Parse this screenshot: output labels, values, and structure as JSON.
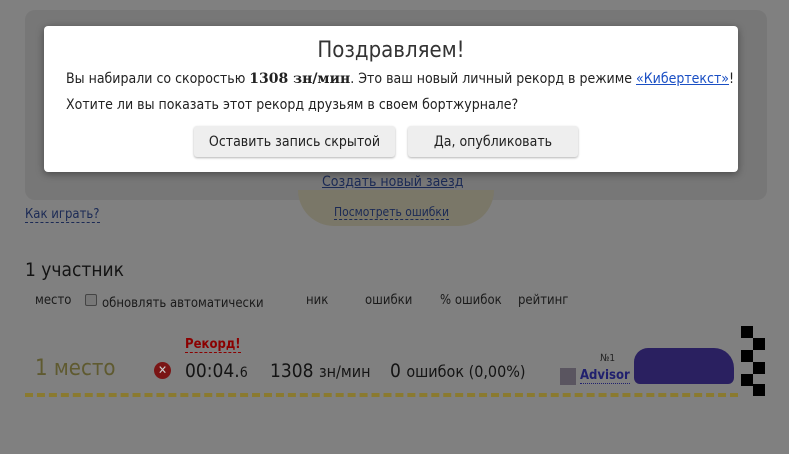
{
  "modal": {
    "title": "Поздравляем!",
    "line1_prefix": "Вы набирали со скоростью ",
    "line1_speed": "1308 зн/мин",
    "line1_middle": ". Это ваш новый личный рекорд в режиме ",
    "mode_link": "«Кибертекст»",
    "line1_suffix": "!",
    "line2": "Хотите ли вы показать этот рекорд друзьям в своем бортжурнале?",
    "keep_hidden_button": "Оставить запись скрытой",
    "publish_button": "Да, опубликовать"
  },
  "links": {
    "new_race": "Создать новый заезд",
    "how_to_play": "Как играть?",
    "view_errors": "Посмотреть ошибки"
  },
  "participants": {
    "title": "1 участник",
    "headers": {
      "place": "место",
      "auto_update": "обновлять автоматически",
      "nick": "ник",
      "errors": "ошибки",
      "error_pct": "% ошибок",
      "rating": "рейтинг"
    },
    "rows": [
      {
        "place": "1 место",
        "record": "Рекорд!",
        "time_main": "00:04.",
        "time_frac": "6",
        "speed": "1308",
        "speed_unit": "зн/мин",
        "errors": "0",
        "errors_text": "ошибок (0,00%)",
        "rank": "№1",
        "nick": "Advisor"
      }
    ]
  },
  "colors": {
    "overlay_bg": "#808080",
    "link": "#1a4fc4",
    "record": "#8b0000"
  }
}
